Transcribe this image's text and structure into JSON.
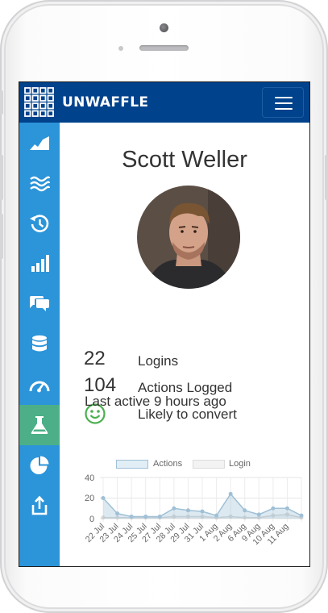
{
  "app": {
    "brand": "UNWAFFLE"
  },
  "colors": {
    "navbar": "#00428c",
    "sidebar": "#2c94d9",
    "sidebar_active": "#4caf87",
    "actions_series": "#9fc0d6",
    "login_series": "#dcdcdc",
    "smiley": "#4caf50"
  },
  "navbar": {
    "menu_icon": "hamburger-icon"
  },
  "sidebar": {
    "items": [
      {
        "icon": "area-chart-icon",
        "active": false
      },
      {
        "icon": "waves-icon",
        "active": false
      },
      {
        "icon": "history-icon",
        "active": false
      },
      {
        "icon": "bar-chart-icon",
        "active": false
      },
      {
        "icon": "chat-bubbles-icon",
        "active": false
      },
      {
        "icon": "database-icon",
        "active": false
      },
      {
        "icon": "speedometer-icon",
        "active": false
      },
      {
        "icon": "flask-icon",
        "active": true
      },
      {
        "icon": "pie-chart-icon",
        "active": false
      },
      {
        "icon": "share-icon",
        "active": false
      }
    ]
  },
  "profile": {
    "name": "Scott Weller",
    "stats": [
      {
        "value": "22",
        "label": "Logins"
      },
      {
        "value": "104",
        "label": "Actions Logged"
      },
      {
        "value": "",
        "label": "Likely to convert",
        "icon": "smiley-icon"
      }
    ],
    "last_active": "Last active 9 hours ago"
  },
  "chart_data": {
    "type": "area",
    "categories": [
      "22 Jul",
      "23 Jul",
      "24 Jul",
      "25 Jul",
      "27 Jul",
      "28 Jul",
      "29 Jul",
      "31 Jul",
      "1 Aug",
      "2 Aug",
      "6 Aug",
      "9 Aug",
      "10 Aug",
      "11 Aug"
    ],
    "series": [
      {
        "name": "Actions",
        "values": [
          20,
          5,
          2,
          2,
          2,
          10,
          8,
          7,
          3,
          24,
          8,
          4,
          10,
          10,
          3
        ]
      },
      {
        "name": "Login",
        "values": [
          1,
          1,
          1,
          1,
          1,
          2,
          2,
          2,
          1,
          2,
          1,
          1,
          3,
          4,
          1
        ]
      }
    ],
    "y_ticks": [
      "40",
      "20",
      "0"
    ],
    "ylim": [
      0,
      40
    ],
    "grid": true,
    "legend_position": "top"
  }
}
